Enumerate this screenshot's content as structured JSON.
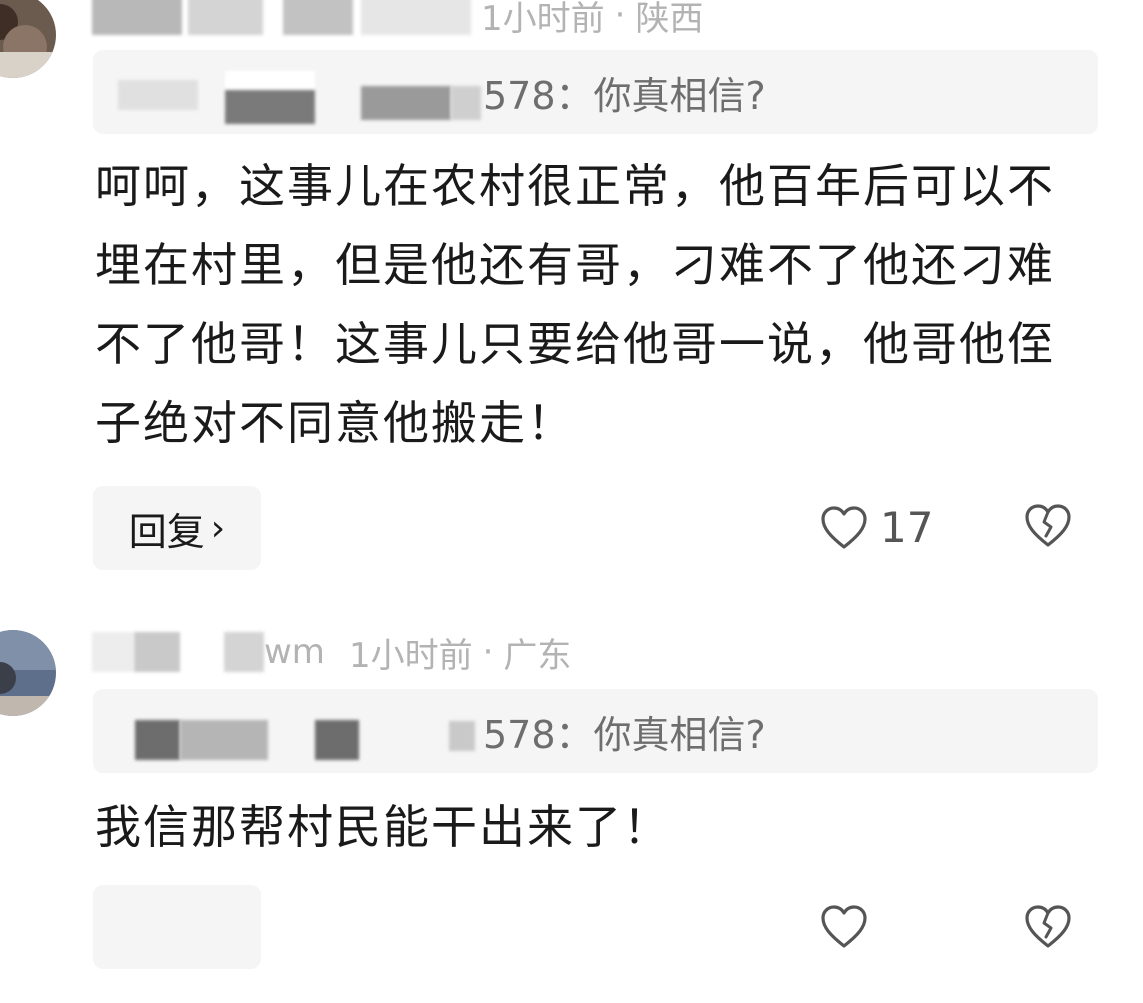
{
  "comments": [
    {
      "meta": {
        "time": "1小时前",
        "separator": "·",
        "location": "陕西"
      },
      "quote": {
        "user_suffix": "578",
        "text": "：你真相信?"
      },
      "body": "呵呵，这事儿在农村很正常，他百年后可以不埋在村里，但是他还有哥，刁难不了他还刁难不了他哥！这事儿只要给他哥一说，他哥他侄子绝对不同意他搬走！",
      "reply": {
        "label": "回复",
        "chevron": "›"
      },
      "likes": "17",
      "icons": {
        "like": "heart-outline-icon",
        "dislike": "broken-heart-icon"
      }
    },
    {
      "meta": {
        "username_suffix": "wm",
        "time": "1小时前",
        "separator": "·",
        "location": "广东"
      },
      "quote": {
        "user_suffix": "578",
        "text": "：你真相信?"
      },
      "body": "我信那帮村民能干出来了！",
      "icons": {
        "like": "heart-outline-icon",
        "dislike": "broken-heart-icon"
      }
    }
  ]
}
